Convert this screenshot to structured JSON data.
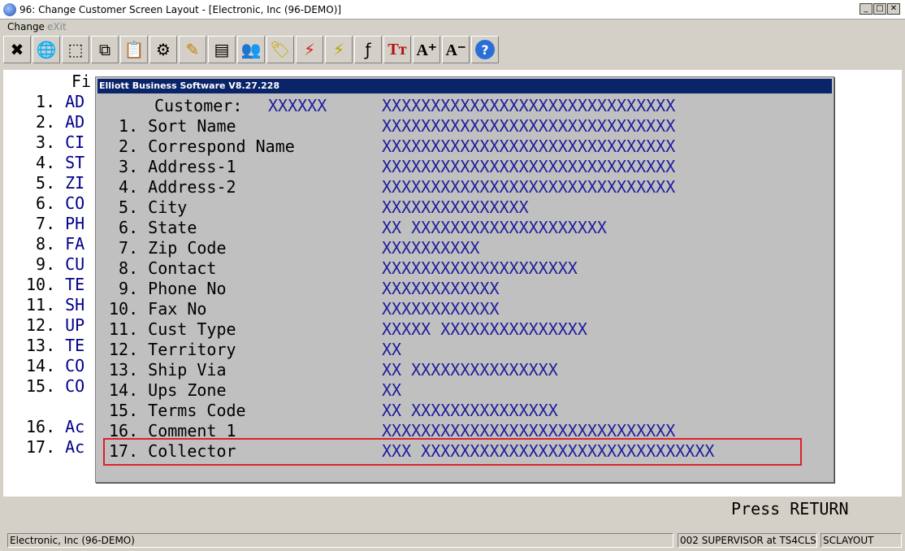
{
  "window": {
    "title": "96: Change Customer Screen Layout - [Electronic, Inc (96-DEMO)]",
    "minimize": "_",
    "maximize": "□",
    "close": "✕"
  },
  "menu": {
    "change": "Change",
    "exit": "eXit"
  },
  "toolbar": {
    "buttons": [
      {
        "icon": "close-x-icon",
        "glyph": "✖"
      },
      {
        "icon": "globe-icon",
        "glyph": "🌐"
      },
      {
        "icon": "select-icon",
        "glyph": "⬚"
      },
      {
        "icon": "copy-icon",
        "glyph": "⧉"
      },
      {
        "icon": "paste-icon",
        "glyph": "📋"
      },
      {
        "icon": "gear-icon",
        "glyph": "⚙"
      },
      {
        "icon": "edit-icon",
        "glyph": "✎"
      },
      {
        "icon": "notes-icon",
        "glyph": "▤"
      },
      {
        "icon": "users-icon",
        "glyph": "👥"
      },
      {
        "icon": "tag-icon",
        "glyph": "🏷"
      },
      {
        "icon": "lightning-icon",
        "glyph": "⚡"
      },
      {
        "icon": "window-lightning-icon",
        "glyph": "⚡"
      },
      {
        "icon": "function-icon",
        "glyph": "ƒ"
      },
      {
        "icon": "font-tt-icon",
        "glyph": "Tт"
      },
      {
        "icon": "font-increase-icon",
        "glyph": "A⁺"
      },
      {
        "icon": "font-decrease-icon",
        "glyph": "A⁻"
      },
      {
        "icon": "help-icon",
        "glyph": "?"
      }
    ]
  },
  "background": {
    "heading": "Fi",
    "rows": [
      {
        "num": " 1.",
        "text": "AD"
      },
      {
        "num": " 2.",
        "text": "AD"
      },
      {
        "num": " 3.",
        "text": "CI"
      },
      {
        "num": " 4.",
        "text": "ST"
      },
      {
        "num": " 5.",
        "text": "ZI"
      },
      {
        "num": " 6.",
        "text": "CO"
      },
      {
        "num": " 7.",
        "text": "PH"
      },
      {
        "num": " 8.",
        "text": "FA"
      },
      {
        "num": " 9.",
        "text": "CU"
      },
      {
        "num": "10.",
        "text": "TE"
      },
      {
        "num": "11.",
        "text": "SH"
      },
      {
        "num": "12.",
        "text": "UP"
      },
      {
        "num": "13.",
        "text": "TE"
      },
      {
        "num": "14.",
        "text": "CO"
      },
      {
        "num": "15.",
        "text": "CO"
      },
      {
        "num": "16.",
        "text": "Ac"
      },
      {
        "num": "17.",
        "text": "Ac"
      }
    ]
  },
  "dialog": {
    "title": "Elliott Business Software V8.27.228",
    "customer_label": "Customer:",
    "customer_code": "XXXXXX",
    "customer_name": "XXXXXXXXXXXXXXXXXXXXXXXXXXXXXX",
    "rows": [
      {
        "label": " 1. Sort Name",
        "value": "XXXXXXXXXXXXXXXXXXXXXXXXXXXXXX"
      },
      {
        "label": " 2. Correspond Name",
        "value": "XXXXXXXXXXXXXXXXXXXXXXXXXXXXXX"
      },
      {
        "label": " 3. Address-1",
        "value": "XXXXXXXXXXXXXXXXXXXXXXXXXXXXXX"
      },
      {
        "label": " 4. Address-2",
        "value": "XXXXXXXXXXXXXXXXXXXXXXXXXXXXXX"
      },
      {
        "label": " 5. City",
        "value": "XXXXXXXXXXXXXXX"
      },
      {
        "label": " 6. State",
        "value": "XX XXXXXXXXXXXXXXXXXXXX"
      },
      {
        "label": " 7. Zip Code",
        "value": "XXXXXXXXXX"
      },
      {
        "label": " 8. Contact",
        "value": "XXXXXXXXXXXXXXXXXXXX"
      },
      {
        "label": " 9. Phone No",
        "value": "XXXXXXXXXXXX"
      },
      {
        "label": "10. Fax No",
        "value": "XXXXXXXXXXXX"
      },
      {
        "label": "11. Cust Type",
        "value": "XXXXX XXXXXXXXXXXXXXX"
      },
      {
        "label": "12. Territory",
        "value": "XX"
      },
      {
        "label": "13. Ship Via",
        "value": "XX XXXXXXXXXXXXXXX"
      },
      {
        "label": "14. Ups Zone",
        "value": "XX"
      },
      {
        "label": "15. Terms Code",
        "value": "XX XXXXXXXXXXXXXXX"
      },
      {
        "label": "16. Comment 1",
        "value": "XXXXXXXXXXXXXXXXXXXXXXXXXXXXXX"
      },
      {
        "label": "17. Collector",
        "value": "XXX XXXXXXXXXXXXXXXXXXXXXXXXXXXXXX"
      }
    ]
  },
  "prompt": "Press RETURN",
  "status": {
    "company": "Electronic, Inc (96-DEMO)",
    "user": "002 SUPERVISOR at TS4CLS",
    "program": "SCLAYOUT"
  },
  "colors": {
    "title_bar": "#0a246a",
    "field_value": "#1c1c9e",
    "highlight_border": "#e0202a"
  }
}
